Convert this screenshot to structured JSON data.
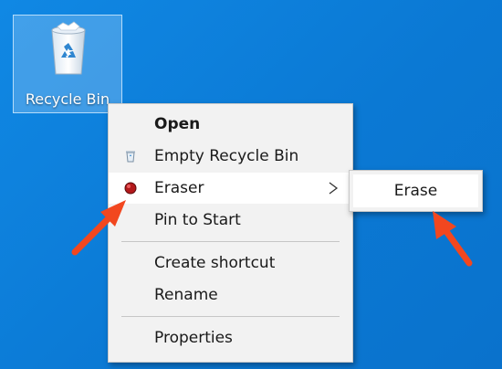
{
  "desktop": {
    "icon": {
      "label": "Recycle Bin",
      "icon_name": "recycle-bin-icon"
    }
  },
  "context_menu": {
    "items": [
      {
        "label": "Open",
        "bold": true,
        "icon": ""
      },
      {
        "label": "Empty Recycle Bin",
        "bold": false,
        "icon": "empty-bin-icon"
      },
      {
        "label": "Eraser",
        "bold": false,
        "icon": "eraser-icon",
        "has_submenu": true,
        "highlighted": true
      },
      {
        "label": "Pin to Start",
        "bold": false,
        "icon": ""
      },
      {
        "label": "Create shortcut",
        "bold": false,
        "icon": ""
      },
      {
        "label": "Rename",
        "bold": false,
        "icon": ""
      },
      {
        "label": "Properties",
        "bold": false,
        "icon": ""
      }
    ]
  },
  "submenu": {
    "items": [
      {
        "label": "Erase",
        "highlighted": true
      }
    ]
  },
  "colors": {
    "desktop_background": "#0b7bd6",
    "menu_background": "#f2f2f2",
    "menu_highlight": "#ffffff",
    "annotation_arrow": "#f2471f"
  }
}
